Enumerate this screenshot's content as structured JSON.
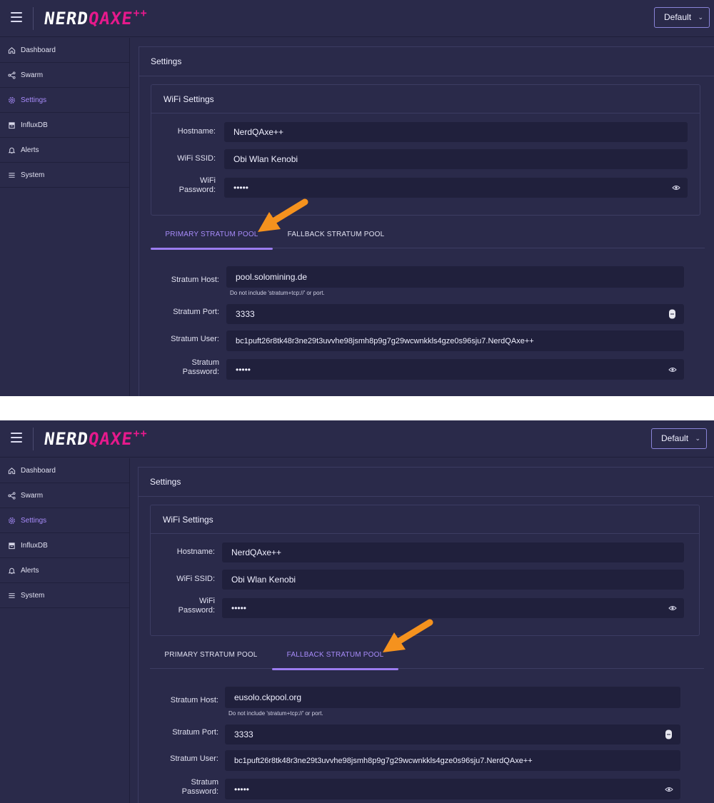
{
  "header": {
    "logo_main": "NERD",
    "logo_accent": "QAXE",
    "logo_plus": "++",
    "theme_select": "Default"
  },
  "sidebar": {
    "items": [
      {
        "label": "Dashboard",
        "icon": "home-icon"
      },
      {
        "label": "Swarm",
        "icon": "share-icon"
      },
      {
        "label": "Settings",
        "icon": "gear-icon",
        "active": true
      },
      {
        "label": "InfluxDB",
        "icon": "database-icon"
      },
      {
        "label": "Alerts",
        "icon": "bell-icon"
      },
      {
        "label": "System",
        "icon": "list-icon"
      }
    ]
  },
  "page_title": "Settings",
  "wifi": {
    "title": "WiFi Settings",
    "hostname_label": "Hostname:",
    "hostname": "NerdQAxe++",
    "ssid_label": "WiFi SSID:",
    "ssid": "Obi Wlan Kenobi",
    "password_label_1": "WiFi",
    "password_label_2": "Password:",
    "password": "•••••"
  },
  "tabs": {
    "primary": "PRIMARY STRATUM POOL",
    "fallback": "FALLBACK STRATUM POOL"
  },
  "stratum_labels": {
    "host": "Stratum Host:",
    "hint": "Do not include 'stratum+tcp://' or port.",
    "port": "Stratum Port:",
    "user": "Stratum User:",
    "password_1": "Stratum",
    "password_2": "Password:"
  },
  "screens": {
    "top": {
      "active_tab": "primary",
      "host": "pool.solomining.de",
      "port": "3333",
      "user": "bc1puft26r8tk48r3ne29t3uvvhe98jsmh8p9g7g29wcwnkkls4gze0s96sju7.NerdQAxe++",
      "password": "•••••"
    },
    "bottom": {
      "active_tab": "fallback",
      "host": "eusolo.ckpool.org",
      "port": "3333",
      "user": "bc1puft26r8tk48r3ne29t3uvvhe98jsmh8p9g7g29wcwnkkls4gze0s96sju7.NerdQAxe++",
      "password": "•••••"
    }
  },
  "colors": {
    "background": "#2a2a4a",
    "accent": "#a78bfa",
    "logo_pink": "#e6198c",
    "arrow": "#f5921e"
  }
}
